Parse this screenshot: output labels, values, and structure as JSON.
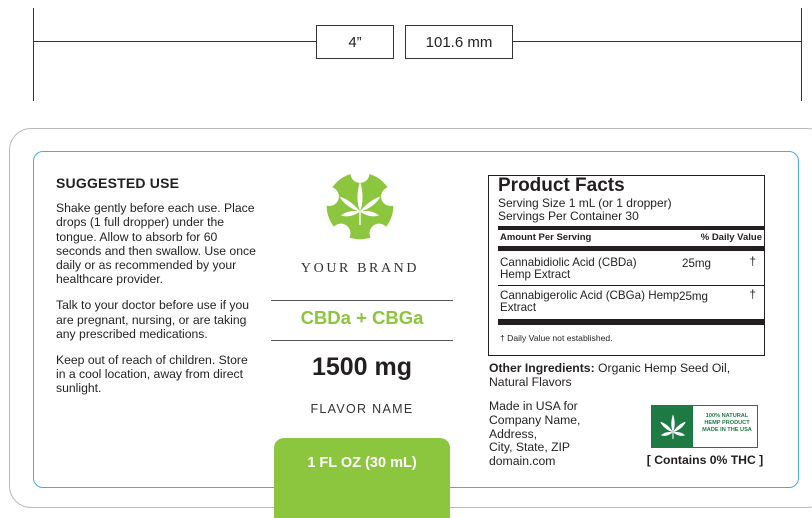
{
  "dimension": {
    "inches": "4”",
    "millimeters": "101.6 mm"
  },
  "suggested_use": {
    "heading": "SUGGESTED USE",
    "paragraph1": "Shake gently before each use. Place drops (1 full dropper) under the tongue. Allow to absorb for 60 seconds and then swallow. Use once daily or as recommended by your healthcare provider.",
    "paragraph2": "Talk to your doctor before use if you are pregnant, nursing, or are taking any prescribed medications.",
    "paragraph3": "Keep out of reach of children. Store in a cool location, away from direct sunlight."
  },
  "center": {
    "logo_icon": "cannabis-leaf-icon",
    "brand": "YOUR BRAND",
    "product": "CBDa + CBGa",
    "strength": "1500 mg",
    "flavor": "FLAVOR NAME",
    "volume": "1 FL OZ (30 mL)"
  },
  "facts": {
    "title": "Product Facts",
    "serving_size": "Serving Size 1 mL (or 1 dropper)",
    "servings_per_container": "Servings Per Container 30",
    "header_left": "Amount Per Serving",
    "header_right": "% Daily Value",
    "rows": [
      {
        "name": "Cannabidiolic Acid (CBDa) Hemp Extract",
        "amount": "25mg",
        "dv": "†"
      },
      {
        "name": "Cannabigerolic Acid (CBGa) Hemp Extract",
        "amount": "25mg",
        "dv": "†"
      }
    ],
    "note": "†  Daily Value not established."
  },
  "other_ingredients": {
    "label": "Other Ingredients:",
    "value": " Organic Hemp Seed Oil, Natural Flavors"
  },
  "made_in": {
    "line1": "Made in USA for",
    "line2": "Company Name,",
    "line3": "Address,",
    "line4": "City, State, ZIP",
    "line5": "domain.com"
  },
  "badge": {
    "icon": "hemp-leaf-icon",
    "line1": "100% NATURAL",
    "line2": "HEMP PRODUCT",
    "line3": "MADE IN THE USA",
    "thc": "[ Contains 0% THC ]"
  },
  "colors": {
    "accent_green": "#8cc63f",
    "badge_green": "#1e7a45",
    "border_blue": "#45b0d6"
  }
}
